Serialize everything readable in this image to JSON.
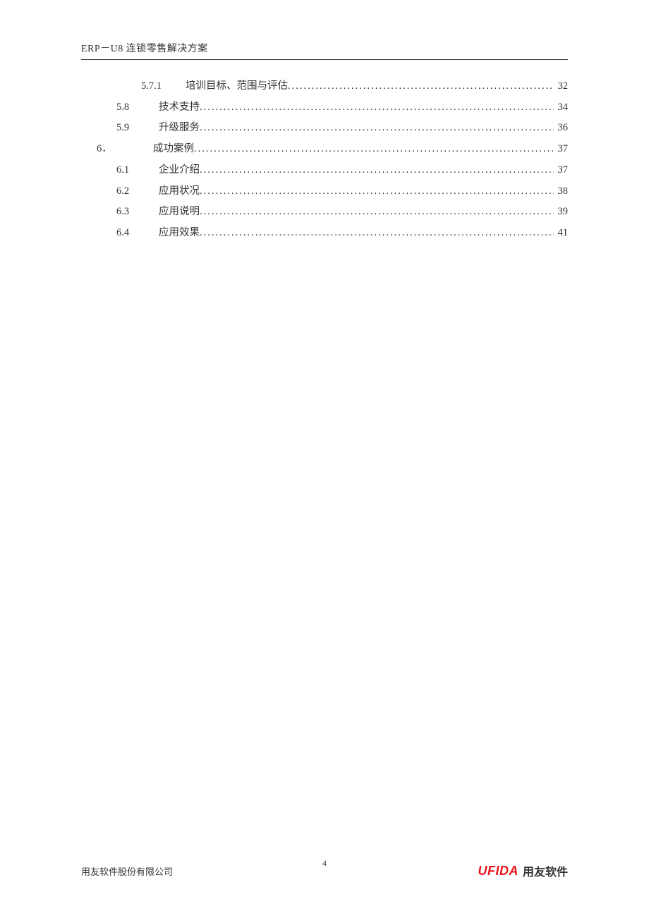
{
  "header": {
    "title": "ERP－U8 连锁零售解决方案"
  },
  "toc": [
    {
      "level": 2,
      "number": "5.7.1",
      "title": "培训目标、范围与评估",
      "page": "32"
    },
    {
      "level": 1,
      "number": "5.8",
      "title": "技术支持",
      "page": "34"
    },
    {
      "level": 1,
      "number": "5.9",
      "title": "升级服务",
      "page": "36"
    },
    {
      "level": 0,
      "number": "6．",
      "title": "成功案例",
      "page": "37"
    },
    {
      "level": 1,
      "number": "6.1",
      "title": "企业介绍",
      "page": "37"
    },
    {
      "level": 1,
      "number": "6.2",
      "title": "应用状况",
      "page": "38"
    },
    {
      "level": 1,
      "number": "6.3",
      "title": "应用说明",
      "page": "39"
    },
    {
      "level": 1,
      "number": "6.4",
      "title": "应用效果",
      "page": "41"
    }
  ],
  "footer": {
    "company": "用友软件股份有限公司",
    "page_number": "4",
    "logo_english": "UFIDA",
    "logo_chinese": "用友软件"
  }
}
